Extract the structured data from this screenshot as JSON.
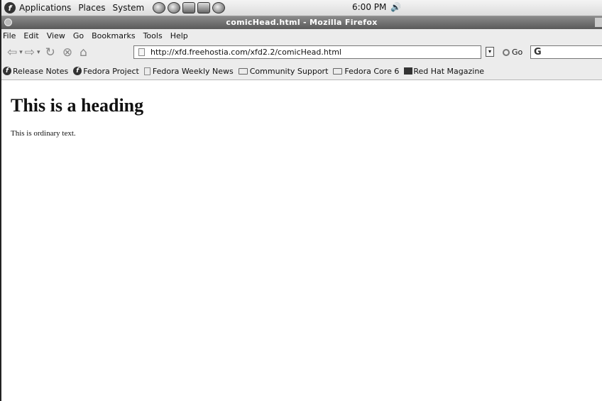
{
  "panel": {
    "applications": "Applications",
    "places": "Places",
    "system": "System",
    "clock": "6:00 PM"
  },
  "window": {
    "title": "comicHead.html - Mozilla Firefox"
  },
  "menubar": {
    "items": [
      "File",
      "Edit",
      "View",
      "Go",
      "Bookmarks",
      "Tools",
      "Help"
    ]
  },
  "navbar": {
    "url": "http://xfd.freehostia.com/xfd2.2/comicHead.html",
    "go_label": "Go",
    "search_value": "G"
  },
  "bookmarks": {
    "items": [
      "Release Notes",
      "Fedora Project",
      "Fedora Weekly News",
      "Community Support",
      "Fedora Core 6",
      "Red Hat Magazine"
    ]
  },
  "page": {
    "heading": "This is a heading",
    "text": "This is ordinary text."
  }
}
